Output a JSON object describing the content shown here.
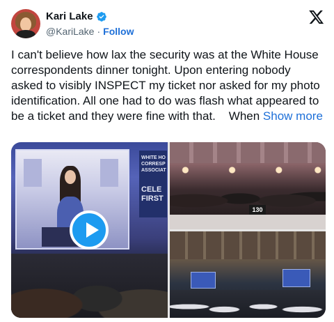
{
  "author": {
    "name": "Kari Lake",
    "handle": "@KariLake",
    "follow_label": "Follow",
    "verified": true
  },
  "icons": {
    "verified": "verified-badge-icon",
    "platform": "x-logo-icon",
    "play": "play-icon"
  },
  "tweet": {
    "text": "I can't believe how lax the security was at the White House correspondents dinner tonight. Upon entering nobody asked to visibly INSPECT my ticket nor asked for my photo identification. All one had to do was flash what appeared to be a ticket and they were fine with that.    When ",
    "show_more": "Show more"
  },
  "media": {
    "banner_text": "WHITE HO\nCORRESP\nASSOCIAT",
    "banner_text2": "CELE\nFIRST",
    "table_number": "130"
  },
  "colors": {
    "link": "#1d6fd8",
    "verified_badge": "#1d9bf0",
    "play_button": "#1d9bf0"
  }
}
